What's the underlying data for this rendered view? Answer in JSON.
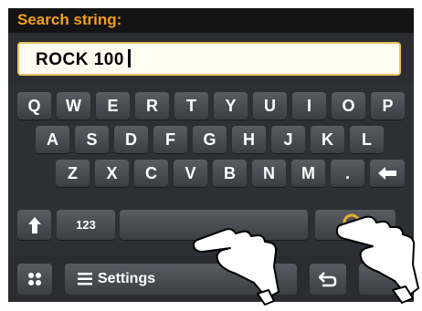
{
  "header": {
    "title": "Search string:"
  },
  "search_field": {
    "value": "ROCK 100"
  },
  "keyboard": {
    "rows": [
      [
        "Q",
        "W",
        "E",
        "R",
        "T",
        "Y",
        "U",
        "I",
        "O",
        "P"
      ],
      [
        "A",
        "S",
        "D",
        "F",
        "G",
        "H",
        "J",
        "K",
        "L"
      ],
      [
        "Z",
        "X",
        "C",
        "V",
        "B",
        "N",
        "M",
        "."
      ]
    ],
    "numeric_toggle_label": "123"
  },
  "bottom_bar": {
    "settings_label": "Settings"
  },
  "icons": {
    "backspace": "arrow-left-icon",
    "shift": "arrow-up-icon",
    "search": "magnifier-icon",
    "menu": "grid-icon",
    "settings": "hamburger-icon",
    "back": "return-arrow-icon"
  },
  "colors": {
    "title": "#f3a018",
    "field_border": "#e9c15f",
    "key_top": "#585c63",
    "key_bottom": "#3b3e43",
    "search_icon": "#e5ad2b"
  }
}
